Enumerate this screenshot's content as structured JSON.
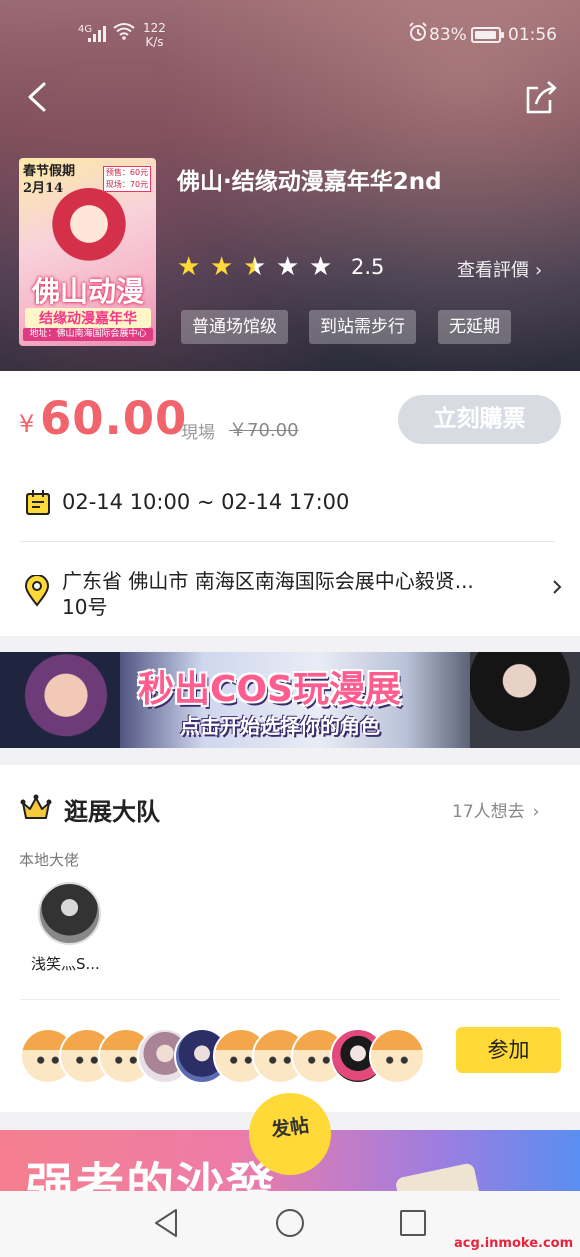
{
  "status_bar": {
    "network": "4G",
    "speed_value": "122",
    "speed_unit": "K/s",
    "battery": "83%",
    "time": "01:56"
  },
  "event": {
    "title": "佛山·结缘动漫嘉年华2nd",
    "rating": "2.5",
    "rating_value": 2.5,
    "rating_max": 5,
    "reviews_link": "查看評價",
    "tags": [
      "普通场馆级",
      "到站需步行",
      "无延期"
    ],
    "poster": {
      "date_line1": "春节假期",
      "date_line2": "2月14",
      "presale": "预售：60元",
      "onsite_price": "现场：70元",
      "brand": "佛山动漫",
      "subtitle": "结缘动漫嘉年华",
      "venue": "地址：佛山南海国际会展中心"
    }
  },
  "pricing": {
    "currency": "¥",
    "price": "60.00",
    "onsite_label": "現場",
    "original_price": "￥70.00",
    "buy_button": "立刻購票"
  },
  "schedule": {
    "time_range": "02-14 10:00 ~ 02-14 17:00"
  },
  "location": {
    "address_line1": "广东省 佛山市 南海区南海国际会展中心毅贤...",
    "address_line2": "10号"
  },
  "promo_banner": {
    "headline": "秒出COS玩漫展",
    "subline": "点击开始选择你的角色"
  },
  "group": {
    "title": "逛展大队",
    "want_count": "17人想去",
    "local_label": "本地大佬",
    "leader_name": "浅笑灬S...",
    "join_button": "参加"
  },
  "bottom_banner": {
    "text": "强者的沙發"
  },
  "fab": {
    "label": "发帖"
  },
  "watermark": "acg.inmoke.com",
  "colors": {
    "price": "#f1646b",
    "star": "#fed937",
    "join": "#fed937",
    "buy_disabled": "#d9dbe2"
  }
}
